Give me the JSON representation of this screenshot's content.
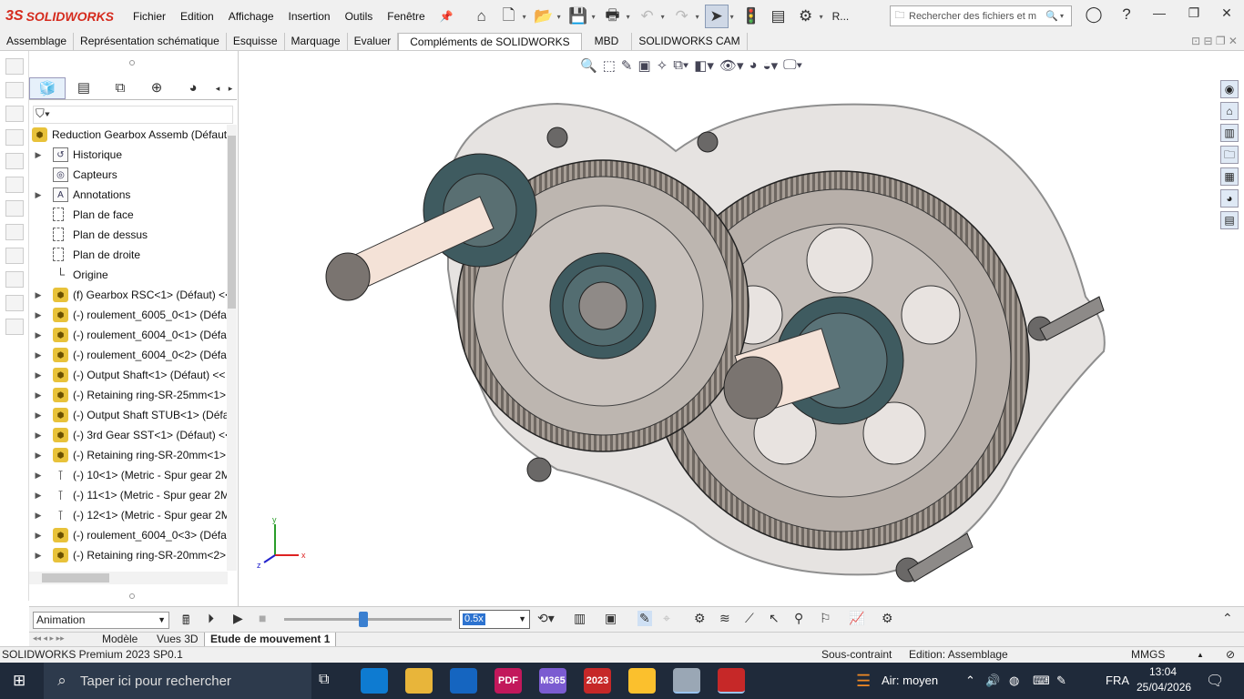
{
  "app": {
    "logo": "SOLIDWORKS",
    "logo_mark": "3S"
  },
  "menu": [
    "Fichier",
    "Edition",
    "Affichage",
    "Insertion",
    "Outils",
    "Fenêtre"
  ],
  "toolbar": {
    "rebuild_letter": "R...",
    "search_placeholder": "Rechercher des fichiers et m"
  },
  "command_tabs": [
    "Assemblage",
    "Représentation schématique",
    "Esquisse",
    "Marquage",
    "Evaluer",
    "Compléments de SOLIDWORKS",
    "MBD",
    "SOLIDWORKS CAM"
  ],
  "command_tabs_active": "Compléments de SOLIDWORKS",
  "tree": {
    "root": "Reduction Gearbox Assemb (Défaut",
    "items": [
      {
        "label": "Historique",
        "icon": "history-folder-icon"
      },
      {
        "label": "Capteurs",
        "icon": "sensor-icon"
      },
      {
        "label": "Annotations",
        "icon": "annotation-icon"
      },
      {
        "label": "Plan de face",
        "icon": "plane-icon"
      },
      {
        "label": "Plan de dessus",
        "icon": "plane-icon"
      },
      {
        "label": "Plan de droite",
        "icon": "plane-icon"
      },
      {
        "label": "Origine",
        "icon": "origin-icon"
      },
      {
        "label": "(f) Gearbox RSC<1> (Défaut) <<",
        "icon": "part-icon"
      },
      {
        "label": "(-) roulement_6005_0<1> (Défa",
        "icon": "part-icon"
      },
      {
        "label": "(-) roulement_6004_0<1> (Défa",
        "icon": "part-icon"
      },
      {
        "label": "(-) roulement_6004_0<2> (Défa",
        "icon": "part-icon"
      },
      {
        "label": "(-) Output Shaft<1> (Défaut) <<",
        "icon": "part-icon"
      },
      {
        "label": "(-) Retaining ring-SR-25mm<1>",
        "icon": "part-icon"
      },
      {
        "label": "(-) Output Shaft STUB<1> (Défa",
        "icon": "part-icon"
      },
      {
        "label": "(-) 3rd Gear SST<1> (Défaut) <<",
        "icon": "part-icon"
      },
      {
        "label": "(-) Retaining ring-SR-20mm<1>",
        "icon": "part-icon"
      },
      {
        "label": "(-) 10<1> (Metric - Spur gear 2M",
        "icon": "bolt-icon"
      },
      {
        "label": "(-) 11<1> (Metric - Spur gear 2M",
        "icon": "bolt-icon"
      },
      {
        "label": "(-) 12<1> (Metric - Spur gear 2M",
        "icon": "bolt-icon"
      },
      {
        "label": "(-) roulement_6004_0<3> (Défa",
        "icon": "part-icon"
      },
      {
        "label": "(-) Retaining ring-SR-20mm<2>",
        "icon": "part-icon"
      }
    ]
  },
  "triad": {
    "x": "x",
    "y": "y",
    "z": "z"
  },
  "animation": {
    "mode": "Animation",
    "speed": "0.5x",
    "slider_fraction": 0.47
  },
  "bottom_tabs": [
    "Modèle",
    "Vues 3D",
    "Etude de mouvement 1"
  ],
  "bottom_tabs_active": "Etude de mouvement 1",
  "status": {
    "product": "SOLIDWORKS Premium 2023 SP0.1",
    "constraint": "Sous-contraint",
    "mode": "Edition: Assemblage",
    "units": "MMGS"
  },
  "taskbar": {
    "search_placeholder": "Taper ici pour rechercher",
    "weather": "Air: moyen",
    "lang": "FRA",
    "time": "13:04",
    "date": "25/04/2026",
    "apps": [
      {
        "label": "",
        "color": "#0e7bd1"
      },
      {
        "label": "",
        "color": "#e8b53a"
      },
      {
        "label": "",
        "color": "#1565c0"
      },
      {
        "label": "PDF",
        "color": "#c2185b"
      },
      {
        "label": "M365",
        "color": "#7b5bd1"
      },
      {
        "label": "2023",
        "color": "#c62828"
      },
      {
        "label": "",
        "color": "#fbc02d"
      },
      {
        "label": "",
        "color": "#9aa7b5"
      },
      {
        "label": "",
        "color": "#c62828"
      }
    ]
  }
}
